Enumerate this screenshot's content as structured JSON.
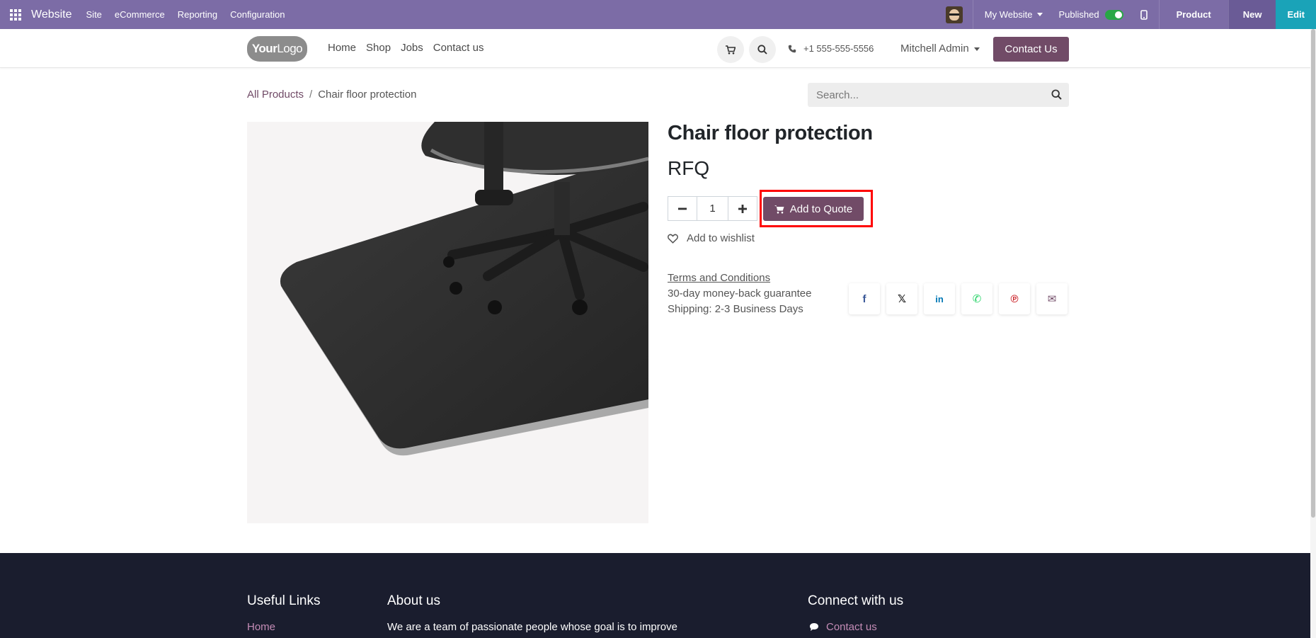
{
  "admin_bar": {
    "app_name": "Website",
    "menu": [
      "Site",
      "eCommerce",
      "Reporting",
      "Configuration"
    ],
    "website_selector": "My Website",
    "published_label": "Published",
    "product_label": "Product",
    "new_label": "New",
    "edit_label": "Edit",
    "toggle_color": "#28a745",
    "bar_color": "#7c6ca6"
  },
  "header": {
    "logo_text_bold": "Your",
    "logo_text_light": "Logo",
    "nav": [
      "Home",
      "Shop",
      "Jobs",
      "Contact us"
    ],
    "phone": "+1 555-555-5556",
    "user": "Mitchell Admin",
    "contact_button": "Contact Us",
    "brand_color": "#714b67"
  },
  "breadcrumb": {
    "root": "All Products",
    "separator": "/",
    "current": "Chair floor protection"
  },
  "search": {
    "placeholder": "Search..."
  },
  "product": {
    "title": "Chair floor protection",
    "price": "RFQ",
    "quantity": "1",
    "add_button": "Add to Quote",
    "wishlist": "Add to wishlist",
    "terms": "Terms and Conditions",
    "guarantee": "30-day money-back guarantee",
    "shipping": "Shipping: 2-3 Business Days",
    "image_icon": "chair-on-floor-mat-image"
  },
  "share_icons": [
    {
      "name": "facebook-icon",
      "glyph": "f",
      "color": "#3b5998"
    },
    {
      "name": "x-icon",
      "glyph": "𝕏",
      "color": "#111111"
    },
    {
      "name": "linkedin-icon",
      "glyph": "in",
      "color": "#0077b5"
    },
    {
      "name": "whatsapp-icon",
      "glyph": "✆",
      "color": "#25d366"
    },
    {
      "name": "pinterest-icon",
      "glyph": "℗",
      "color": "#cb2027"
    },
    {
      "name": "email-icon",
      "glyph": "✉",
      "color": "#714b67"
    }
  ],
  "footer": {
    "useful_links_title": "Useful Links",
    "useful_links_first": "Home",
    "about_title": "About us",
    "about_text": "We are a team of passionate people whose goal is to improve",
    "connect_title": "Connect with us",
    "connect_first": "Contact us"
  }
}
